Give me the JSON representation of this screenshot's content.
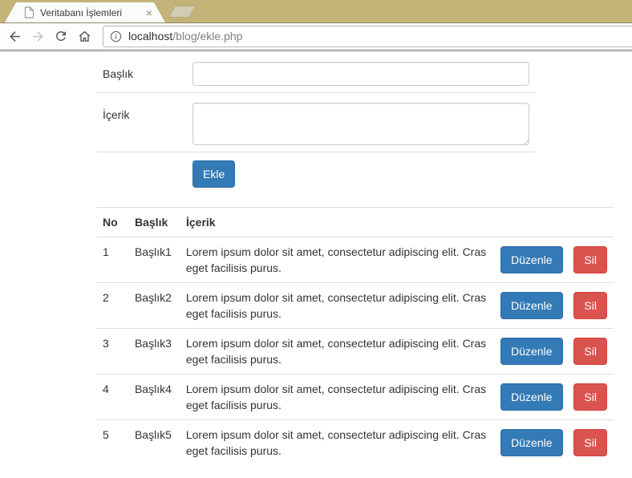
{
  "browser": {
    "tab_title": "Veritabanı İşlemleri",
    "tab_close": "×",
    "url_host": "localhost",
    "url_path": "/blog/ekle.php"
  },
  "icons": {
    "tab_favicon": "document-icon",
    "back": "back-arrow-icon",
    "forward": "forward-arrow-icon",
    "reload": "reload-icon",
    "home": "home-icon",
    "url_info": "info-icon"
  },
  "form": {
    "title_label": "Başlık",
    "title_value": "",
    "content_label": "İçerik",
    "content_value": "",
    "submit_label": "Ekle"
  },
  "table": {
    "headers": {
      "no": "No",
      "title": "Başlık",
      "content": "İçerik"
    },
    "rows": [
      {
        "no": "1",
        "title": "Başlık1",
        "content": "Lorem ipsum dolor sit amet, consectetur adipiscing elit. Cras eget facilisis purus.",
        "edit": "Düzenle",
        "delete": "Sil"
      },
      {
        "no": "2",
        "title": "Başlık2",
        "content": "Lorem ipsum dolor sit amet, consectetur adipiscing elit. Cras eget facilisis purus.",
        "edit": "Düzenle",
        "delete": "Sil"
      },
      {
        "no": "3",
        "title": "Başlık3",
        "content": "Lorem ipsum dolor sit amet, consectetur adipiscing elit. Cras eget facilisis purus.",
        "edit": "Düzenle",
        "delete": "Sil"
      },
      {
        "no": "4",
        "title": "Başlık4",
        "content": "Lorem ipsum dolor sit amet, consectetur adipiscing elit. Cras eget facilisis purus.",
        "edit": "Düzenle",
        "delete": "Sil"
      },
      {
        "no": "5",
        "title": "Başlık5",
        "content": "Lorem ipsum dolor sit amet, consectetur adipiscing elit. Cras eget facilisis purus.",
        "edit": "Düzenle",
        "delete": "Sil"
      }
    ]
  },
  "colors": {
    "primary": "#337ab7",
    "primary_border": "#2e6da4",
    "danger": "#d9534f",
    "danger_border": "#d43f3a",
    "chrome_frame": "#c4b377",
    "divider": "#dddddd",
    "text": "#333333"
  }
}
